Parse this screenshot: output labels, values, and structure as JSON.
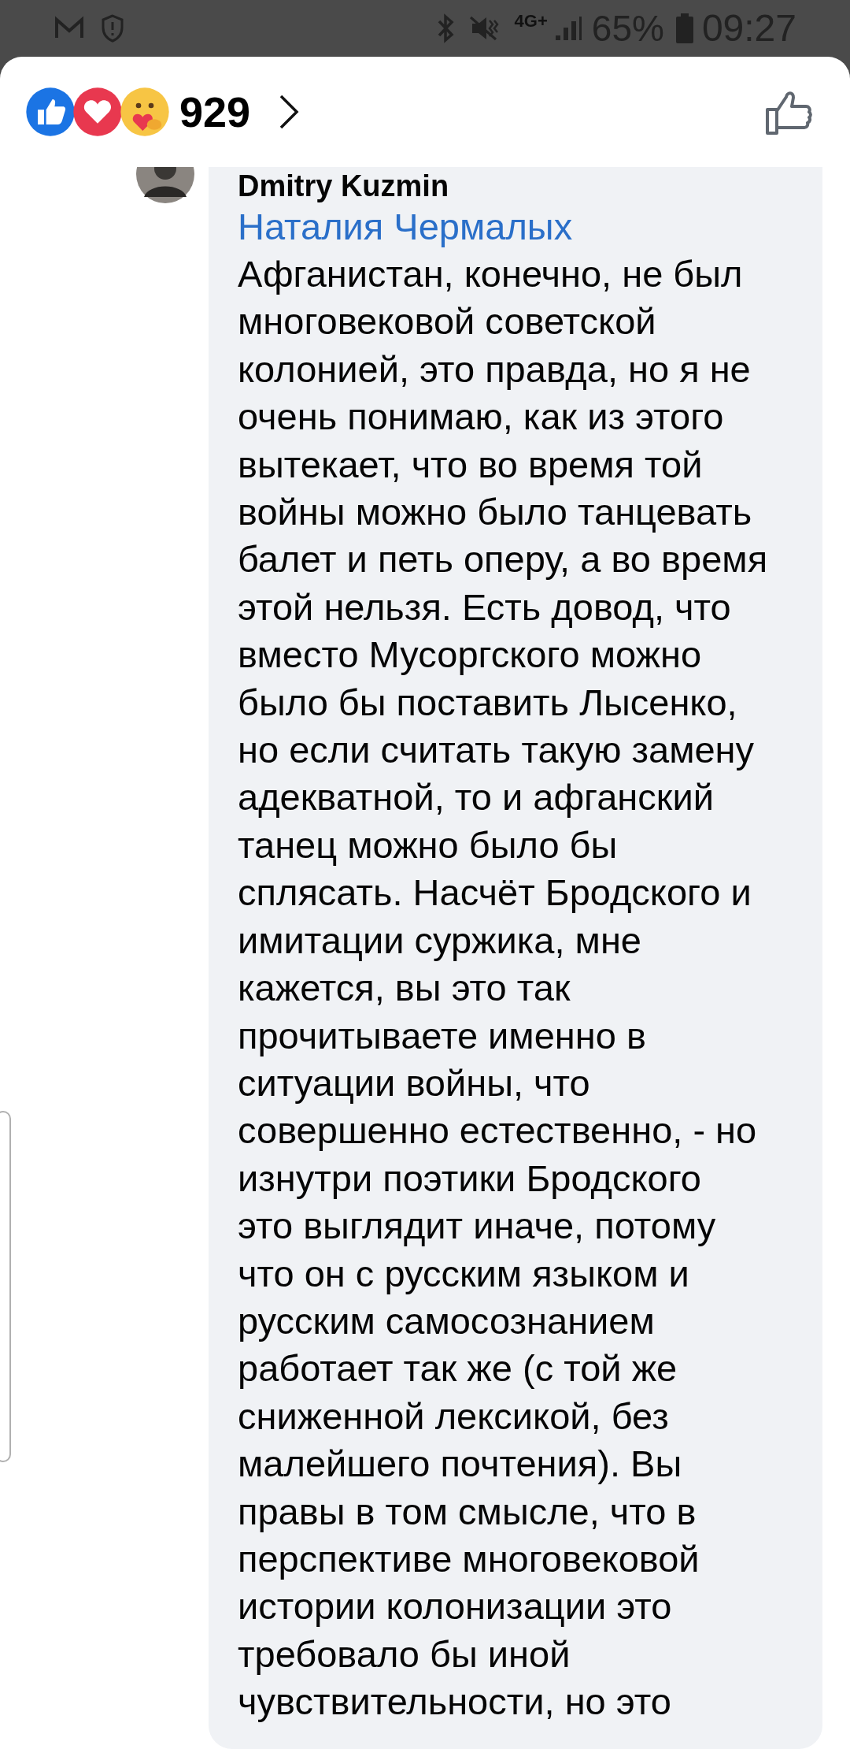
{
  "status_bar": {
    "network": "4G+",
    "battery": "65%",
    "time": "09:27"
  },
  "reactions": {
    "count": "929"
  },
  "comment": {
    "author": "Dmitry Kuzmin",
    "mention": "Наталия Чермалых",
    "lines": [
      "Афганистан, конечно, не был",
      "многовековой советской",
      "колонией, это правда, но я не",
      "очень понимаю, как из этого",
      "вытекает, что во время той",
      "войны можно было танцевать",
      "балет и петь оперу, а во время",
      "этой нельзя. Есть довод, что",
      "вместо Мусоргского можно",
      "было бы поставить Лысенко,",
      "но если считать такую замену",
      "адекватной, то и афганский",
      "танец можно было бы",
      "сплясать. Насчёт Бродского и",
      "имитации суржика, мне",
      "кажется, вы это так",
      "прочитываете именно в",
      "ситуации войны, что",
      "совершенно естественно, - но",
      "изнутри поэтики Бродского",
      "это выглядит иначе, потому",
      "что он с русским языком и",
      "русским самосознанием",
      "работает так же (с той же",
      "сниженной лексикой, без",
      "малейшего почтения). Вы",
      "правы в том смысле, что в",
      "перспективе многовековой",
      "истории колонизации это",
      "требовало бы иной",
      "чувствительности, но это"
    ]
  }
}
